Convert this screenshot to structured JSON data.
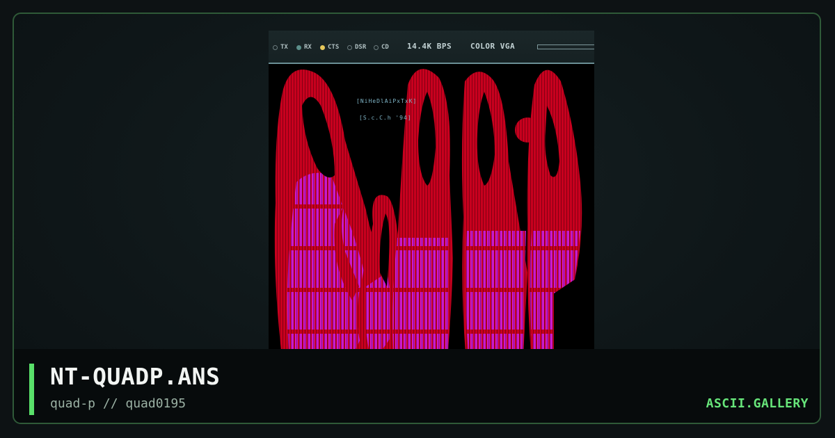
{
  "viewer": {
    "status": {
      "indicators": [
        {
          "label": "TX",
          "state": "off"
        },
        {
          "label": "RX",
          "state": "on"
        },
        {
          "label": "CTS",
          "state": "active"
        },
        {
          "label": "DSR",
          "state": "off"
        },
        {
          "label": "CD",
          "state": "off"
        }
      ],
      "speed": "14.4K BPS",
      "mode": "COLOR VGA"
    },
    "artwork": {
      "text_lines": [
        "[NiHeDlAiPxTxK]",
        "[S.c.C.h '94]"
      ],
      "palette": {
        "primary": "#c8001e",
        "secondary": "#cc19cc",
        "background": "#000000"
      }
    }
  },
  "caption": {
    "filename": "NT-QUADP.ANS",
    "author_line": "quad-p // quad0195",
    "brand": "ASCII.GALLERY"
  },
  "colors": {
    "accent": "#59e06a",
    "frame_border": "#2f5a38",
    "background": "#0d1214"
  }
}
